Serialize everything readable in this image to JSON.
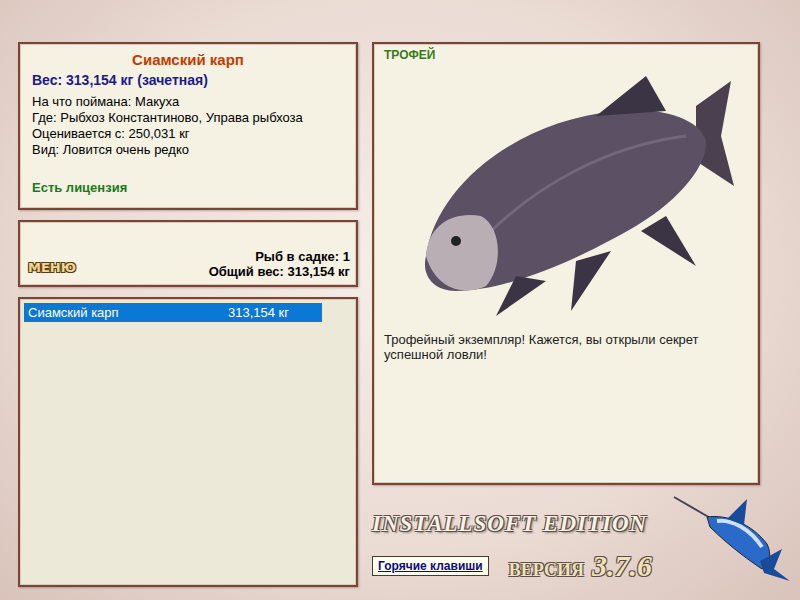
{
  "fish_card": {
    "title": "Сиамский карп",
    "weight": "Вес: 313,154 кг (зачетная)",
    "details": [
      "На что поймана: Макуха",
      "Где: Рыбхоз Константиново, Управа рыбхоза",
      "Оценивается с: 250,031 кг",
      "Вид: Ловится очень редко"
    ],
    "license": "Есть лицензия"
  },
  "keepnet": {
    "menu": "МЕНЮ",
    "count": "Рыб в садке: 1",
    "total": "Общий вес: 313,154 кг"
  },
  "catch_list": [
    {
      "name": "Сиамский карп",
      "weight": "313,154 кг",
      "selected": true
    }
  ],
  "trophy": {
    "label": "ТРОФЕЙ",
    "message": "Трофейный экземпляр! Кажется, вы открыли секрет успешной ловли!"
  },
  "footer": {
    "edition": "INSTALLSOFT EDITION",
    "version_label": "ВЕРСИЯ",
    "version": "3.7.6",
    "hotkeys": "Горячие клавиши"
  }
}
